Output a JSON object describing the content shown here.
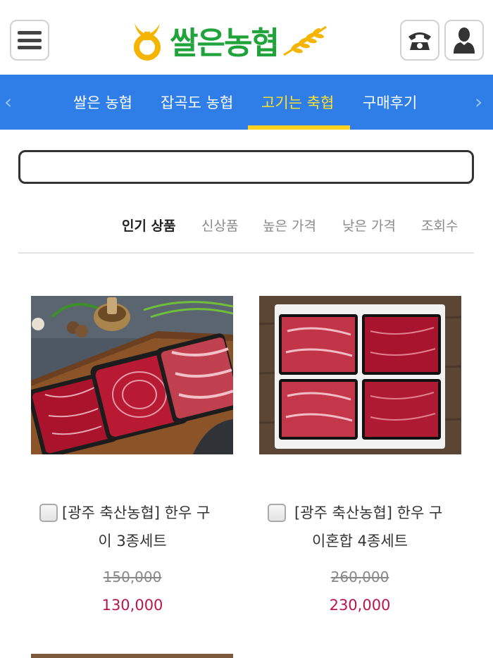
{
  "header": {
    "logo_text": "쌀은농협",
    "menu_icon": "hamburger-menu-icon",
    "phone_icon": "phone-icon",
    "user_icon": "user-icon"
  },
  "nav": {
    "items": [
      {
        "label": "쌀은 농협",
        "active": false
      },
      {
        "label": "잡곡도 농협",
        "active": false
      },
      {
        "label": "고기는 축협",
        "active": true
      },
      {
        "label": "구매후기",
        "active": false
      }
    ],
    "prev_icon": "chevron-left-icon",
    "next_icon": "chevron-right-icon",
    "bg_color": "#2f7ee8",
    "active_color": "#ffe02b"
  },
  "search": {
    "value": "",
    "placeholder": ""
  },
  "sort": {
    "tabs": [
      {
        "label": "인기 상품",
        "active": true
      },
      {
        "label": "신상품",
        "active": false
      },
      {
        "label": "높은 가격",
        "active": false
      },
      {
        "label": "낮은 가격",
        "active": false
      },
      {
        "label": "조회수",
        "active": false
      }
    ]
  },
  "products": [
    {
      "title_line1": "[광주 축산농협] 한우 구",
      "title_line2": "이 3종세트",
      "price_original": "150,000",
      "price_sale": "130,000",
      "checked": false
    },
    {
      "title_line1": "[광주 축산농협] 한우 구",
      "title_line2": "이혼합 4종세트",
      "price_original": "260,000",
      "price_sale": "230,000",
      "checked": false
    }
  ],
  "colors": {
    "brand_green": "#1fa33a",
    "sale_price": "#b8174a"
  }
}
